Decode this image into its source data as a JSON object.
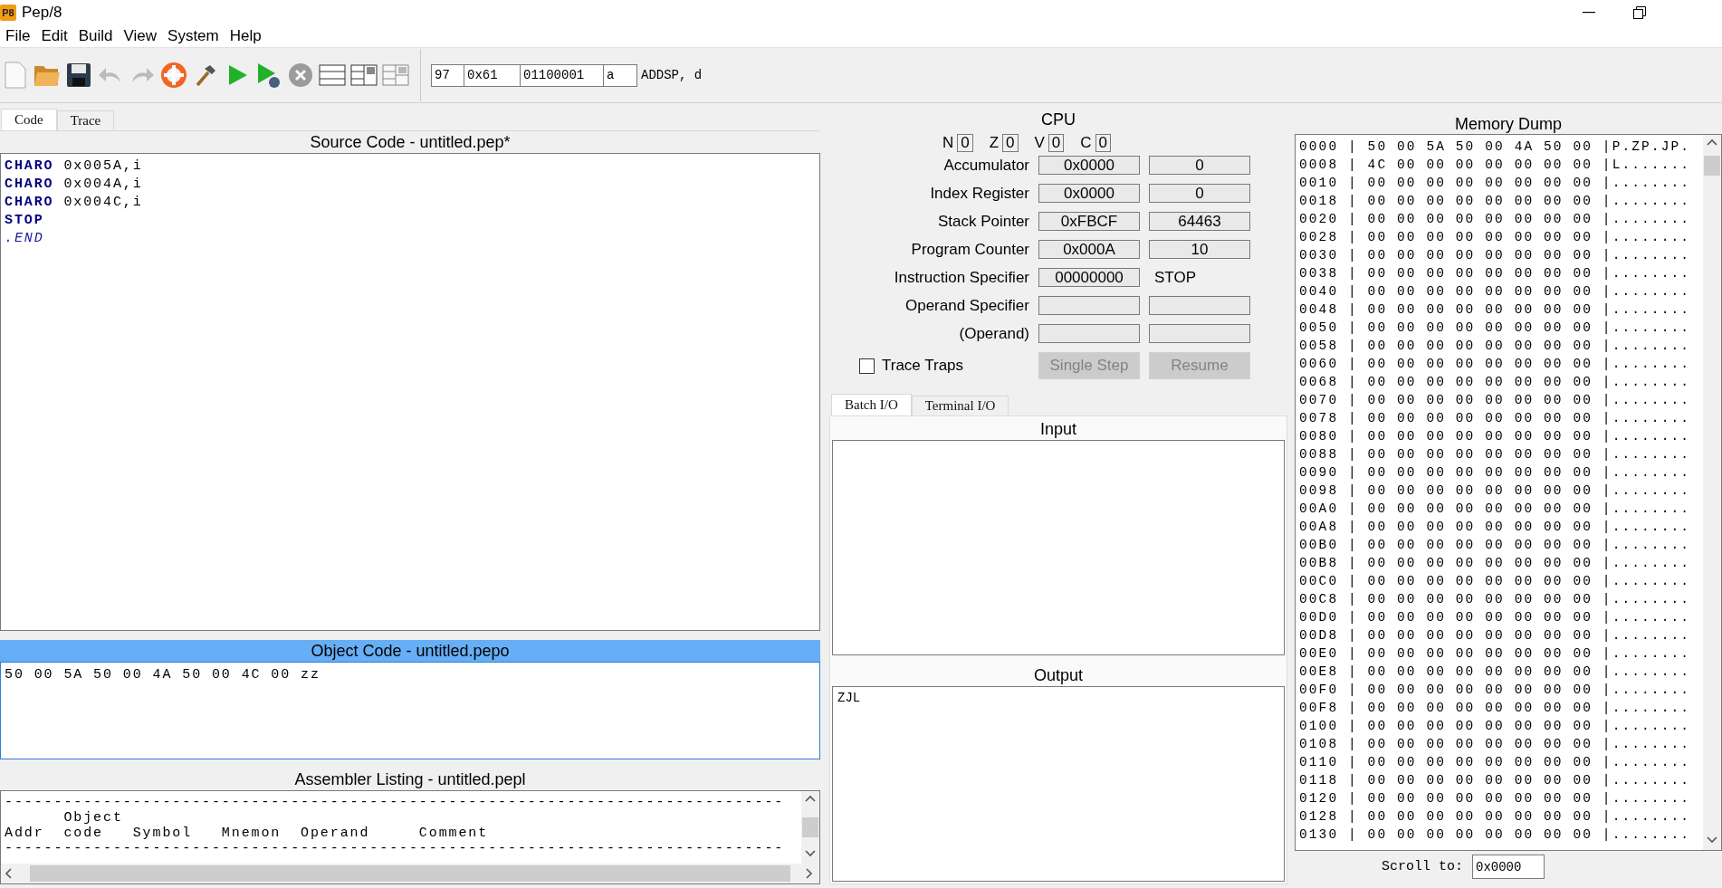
{
  "window": {
    "icon_text": "P8",
    "title": "Pep/8"
  },
  "menu": [
    "File",
    "Edit",
    "Build",
    "View",
    "System",
    "Help"
  ],
  "toolbar": [
    {
      "kind": "new",
      "disabled": false
    },
    {
      "kind": "open",
      "disabled": false
    },
    {
      "kind": "save",
      "disabled": false
    },
    {
      "kind": "undo",
      "disabled": true
    },
    {
      "kind": "redo",
      "disabled": true
    },
    {
      "kind": "help",
      "disabled": false
    },
    {
      "kind": "build",
      "disabled": false
    },
    {
      "kind": "run",
      "disabled": false
    },
    {
      "kind": "debug",
      "disabled": false
    },
    {
      "kind": "stop",
      "disabled": true
    },
    {
      "kind": "layout-single",
      "disabled": false
    },
    {
      "kind": "layout-split",
      "disabled": false
    },
    {
      "kind": "layout-triple",
      "disabled": true
    }
  ],
  "converter": {
    "fields": [
      "97",
      "0x61",
      "01100001",
      "a"
    ],
    "mnemonic": "ADDSP, d"
  },
  "left_tabs": [
    {
      "label": "Code",
      "selected": true
    },
    {
      "label": "Trace",
      "selected": false
    }
  ],
  "source": {
    "title": "Source Code - untitled.pep*",
    "active": false,
    "lines": [
      {
        "kind": "code",
        "text": "**CHARO** 0x005A,i"
      },
      {
        "kind": "code",
        "text": "**CHARO** 0x004A,i"
      },
      {
        "kind": "code",
        "text": "**CHARO** 0x004C,i"
      },
      {
        "kind": "code",
        "text": "**STOP**"
      },
      {
        "kind": "directive",
        "text": ".END"
      }
    ]
  },
  "object_code": {
    "title": "Object Code - untitled.pepo",
    "active": true,
    "text": "50 00 5A 50 00 4A 50 00 4C 00 zz"
  },
  "listing": {
    "title": "Assembler Listing - untitled.pepl",
    "active": false,
    "lines": [
      "-------------------------------------------------------------------------------",
      "      Object",
      "Addr  code   Symbol   Mnemon  Operand     Comment",
      "-------------------------------------------------------------------------------"
    ]
  },
  "cpu": {
    "title": "CPU",
    "flags": [
      {
        "name": "N",
        "value": "0"
      },
      {
        "name": "Z",
        "value": "0"
      },
      {
        "name": "V",
        "value": "0"
      },
      {
        "name": "C",
        "value": "0"
      }
    ],
    "registers": [
      {
        "kind": "register",
        "label": "Accumulator",
        "hex": "0x0000",
        "dec": "0"
      },
      {
        "kind": "register",
        "label": "Index Register",
        "hex": "0x0000",
        "dec": "0"
      },
      {
        "kind": "register",
        "label": "Stack Pointer",
        "hex": "0xFBCF",
        "dec": "64463"
      },
      {
        "kind": "register",
        "label": "Program Counter",
        "hex": "0x000A",
        "dec": "10"
      },
      {
        "kind": "instruction",
        "label": "Instruction Specifier",
        "hex": "00000000",
        "mnemonic": "STOP"
      },
      {
        "kind": "register",
        "label": "Operand Specifier"
      },
      {
        "kind": "register",
        "label": "(Operand)"
      }
    ],
    "trace_traps": {
      "label": "Trace Traps",
      "checked": false
    },
    "buttons": [
      {
        "label": "Single Step",
        "disabled": true
      },
      {
        "label": "Resume",
        "disabled": true
      }
    ]
  },
  "io_tabs": [
    {
      "label": "Batch I/O",
      "selected": true
    },
    {
      "label": "Terminal I/O",
      "selected": false
    }
  ],
  "input": {
    "title": "Input"
  },
  "output": {
    "title": "Output",
    "text": "ZJL"
  },
  "memory": {
    "title": "Memory Dump",
    "rows": [
      "0000 | 50 00 5A 50 00 4A 50 00 |P.ZP.JP.",
      "0008 | 4C 00 00 00 00 00 00 00 |L.......",
      "0010 | 00 00 00 00 00 00 00 00 |........",
      "0018 | 00 00 00 00 00 00 00 00 |........",
      "0020 | 00 00 00 00 00 00 00 00 |........",
      "0028 | 00 00 00 00 00 00 00 00 |........",
      "0030 | 00 00 00 00 00 00 00 00 |........",
      "0038 | 00 00 00 00 00 00 00 00 |........",
      "0040 | 00 00 00 00 00 00 00 00 |........",
      "0048 | 00 00 00 00 00 00 00 00 |........",
      "0050 | 00 00 00 00 00 00 00 00 |........",
      "0058 | 00 00 00 00 00 00 00 00 |........",
      "0060 | 00 00 00 00 00 00 00 00 |........",
      "0068 | 00 00 00 00 00 00 00 00 |........",
      "0070 | 00 00 00 00 00 00 00 00 |........",
      "0078 | 00 00 00 00 00 00 00 00 |........",
      "0080 | 00 00 00 00 00 00 00 00 |........",
      "0088 | 00 00 00 00 00 00 00 00 |........",
      "0090 | 00 00 00 00 00 00 00 00 |........",
      "0098 | 00 00 00 00 00 00 00 00 |........",
      "00A0 | 00 00 00 00 00 00 00 00 |........",
      "00A8 | 00 00 00 00 00 00 00 00 |........",
      "00B0 | 00 00 00 00 00 00 00 00 |........",
      "00B8 | 00 00 00 00 00 00 00 00 |........",
      "00C0 | 00 00 00 00 00 00 00 00 |........",
      "00C8 | 00 00 00 00 00 00 00 00 |........",
      "00D0 | 00 00 00 00 00 00 00 00 |........",
      "00D8 | 00 00 00 00 00 00 00 00 |........",
      "00E0 | 00 00 00 00 00 00 00 00 |........",
      "00E8 | 00 00 00 00 00 00 00 00 |........",
      "00F0 | 00 00 00 00 00 00 00 00 |........",
      "00F8 | 00 00 00 00 00 00 00 00 |........",
      "0100 | 00 00 00 00 00 00 00 00 |........",
      "0108 | 00 00 00 00 00 00 00 00 |........",
      "0110 | 00 00 00 00 00 00 00 00 |........",
      "0118 | 00 00 00 00 00 00 00 00 |........",
      "0120 | 00 00 00 00 00 00 00 00 |........",
      "0128 | 00 00 00 00 00 00 00 00 |........",
      "0130 | 00 00 00 00 00 00 00 00 |........"
    ],
    "scroll_label": "Scroll to:",
    "scroll_value": "0x0000"
  }
}
